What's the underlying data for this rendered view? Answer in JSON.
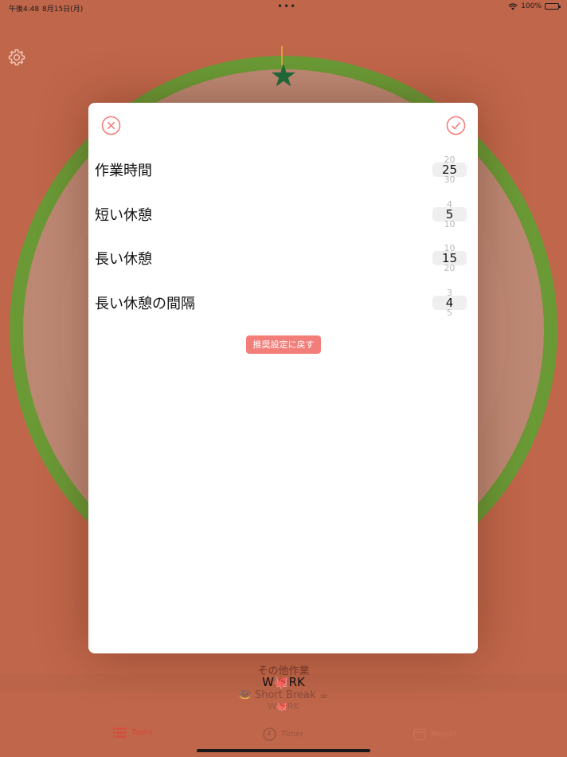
{
  "status": {
    "time": "午後4:48",
    "date": "8月15日(月)",
    "dots": "•••",
    "battery": "100%"
  },
  "settings_modal": {
    "rows": [
      {
        "label": "作業時間",
        "prev": "20",
        "value": "25",
        "next": "30"
      },
      {
        "label": "短い休憩",
        "prev": "4",
        "value": "5",
        "next": "10"
      },
      {
        "label": "長い休憩",
        "prev": "10",
        "value": "15",
        "next": "20"
      },
      {
        "label": "長い休憩の間隔",
        "prev": "3",
        "value": "4",
        "next": "5"
      }
    ],
    "reset_label": "推奨設定に戻す"
  },
  "background": {
    "task_name": "その他作業",
    "schedule": [
      "W🐙RK",
      "🍩 Short Break ☕",
      "W🐙RK"
    ]
  },
  "tabs": [
    {
      "label": "Tasks",
      "icon": "list-icon"
    },
    {
      "label": "Timer",
      "icon": "clock-icon"
    },
    {
      "label": "Report",
      "icon": "calendar-icon"
    }
  ],
  "colors": {
    "background": "#c0664a",
    "ring": "#6a9a36",
    "accent": "#f27e7a",
    "star": "#1f6b3a"
  }
}
